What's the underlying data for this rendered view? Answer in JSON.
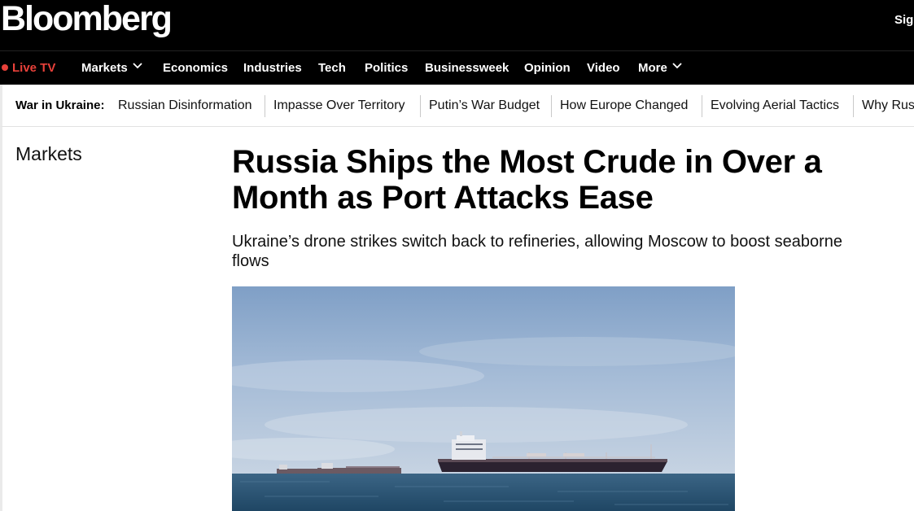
{
  "header": {
    "logo": "Bloomberg",
    "signin_label": "Sign"
  },
  "nav": {
    "live_label": "Live TV",
    "items": [
      "Markets",
      "Economics",
      "Industries",
      "Tech",
      "Politics",
      "Businessweek",
      "Opinion",
      "Video",
      "More"
    ]
  },
  "topics": {
    "label": "War in Ukraine:",
    "items": [
      "Russian Disinformation",
      "Impasse Over Territory",
      "Putin’s War Budget",
      "How Europe Changed",
      "Evolving Aerial Tactics",
      "Why Rus"
    ]
  },
  "article": {
    "section": "Markets",
    "headline": "Russia Ships the Most Crude in Over a Month as Port Attacks Ease",
    "dek": "Ukraine’s drone strikes switch back to refineries, allowing Moscow to boost seaborne flows"
  },
  "image": {
    "subject": "oil-tankers-at-sea",
    "sky_color": "#a9bfd8",
    "sea_color": "#2c5675"
  },
  "colors": {
    "live_red": "#e8413a",
    "bar_black": "#000000"
  }
}
